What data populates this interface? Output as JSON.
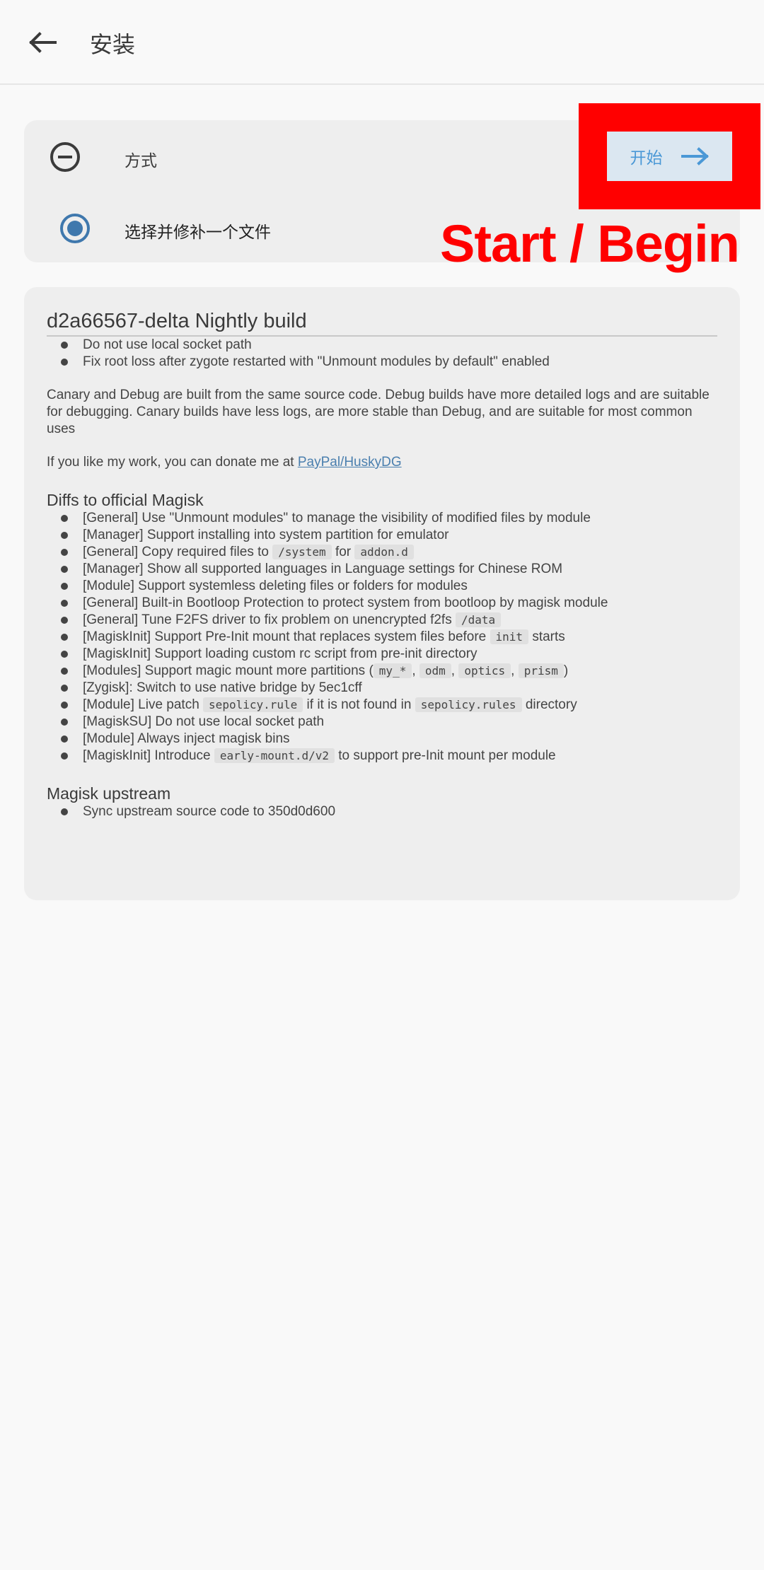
{
  "appbar": {
    "title": "安装",
    "back_icon": "arrow-left-icon"
  },
  "method": {
    "label": "方式",
    "option_label": "选择并修补一个文件",
    "start_label": "开始",
    "annotation": "Start / Begin"
  },
  "notes": {
    "title": "d2a66567-delta Nightly build",
    "list_a": [
      "Do not use local socket path",
      "Fix root loss after zygote restarted with \"Unmount modules by default\" enabled"
    ],
    "para1": "Canary and Debug are built from the same source code.  Debug builds have more detailed logs and are suitable for debugging. Canary builds have less logs, are more stable than Debug, and are suitable for most common uses",
    "para2_prefix": "If you like my work, you can donate me at ",
    "para2_link": "PayPal/HuskyDG",
    "diffs_heading": "Diffs to official Magisk",
    "diffs": [
      {
        "parts": [
          "[General] Use \"Unmount modules\" to manage the visibility of modified files by module"
        ]
      },
      {
        "parts": [
          "[Manager] Support installing into system partition for emulator"
        ]
      },
      {
        "parts": [
          "[General] Copy required files to ",
          {
            "code": "/system"
          },
          " for ",
          {
            "code": "addon.d"
          }
        ]
      },
      {
        "parts": [
          "[Manager] Show all supported languages in Language settings for Chinese ROM"
        ]
      },
      {
        "parts": [
          "[Module] Support systemless deleting files or folders for modules"
        ]
      },
      {
        "parts": [
          "[General] Built-in Bootloop Protection to protect system from bootloop by magisk module"
        ]
      },
      {
        "parts": [
          "[General] Tune F2FS driver to fix problem on unencrypted f2fs ",
          {
            "code": "/data"
          }
        ]
      },
      {
        "parts": [
          "[MagiskInit] Support Pre-Init mount that replaces system files before ",
          {
            "code": "init"
          },
          " starts"
        ]
      },
      {
        "parts": [
          "[MagiskInit] Support loading custom rc script from pre-init directory"
        ]
      },
      {
        "parts": [
          "[Modules] Support magic mount more partitions (",
          {
            "code": "my_*"
          },
          ", ",
          {
            "code": "odm"
          },
          ", ",
          {
            "code": "optics"
          },
          ", ",
          {
            "code": "prism"
          },
          ")"
        ]
      },
      {
        "parts": [
          "[Zygisk]: Switch to use native bridge by 5ec1cff"
        ]
      },
      {
        "parts": [
          "[Module] Live patch ",
          {
            "code": "sepolicy.rule"
          },
          " if it is not found in ",
          {
            "code": "sepolicy.rules"
          },
          " directory"
        ]
      },
      {
        "parts": [
          "[MagiskSU] Do not use local socket path"
        ]
      },
      {
        "parts": [
          "[Module] Always inject magisk bins"
        ]
      },
      {
        "parts": [
          "[MagiskInit] Introduce ",
          {
            "code": "early-mount.d/v2"
          },
          " to support pre-Init mount per module"
        ]
      }
    ],
    "upstream_heading": "Magisk upstream",
    "upstream": [
      "Sync upstream source code to 350d0d600"
    ]
  },
  "colors": {
    "accent": "#4a98d6",
    "highlight": "#ff0000",
    "radio": "#3f78ad"
  }
}
